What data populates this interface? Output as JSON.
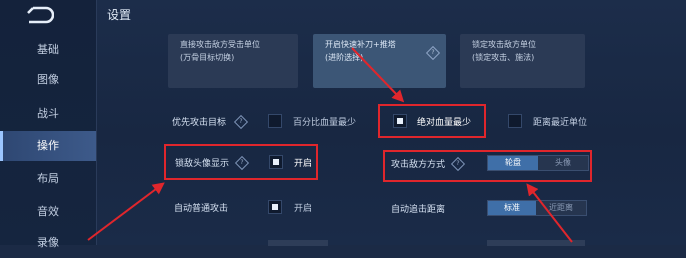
{
  "page": {
    "title": "设置"
  },
  "sidebar": {
    "items": [
      {
        "label": "基础"
      },
      {
        "label": "图像"
      },
      {
        "label": "战斗"
      },
      {
        "label": "操作",
        "active": true
      },
      {
        "label": "布局"
      },
      {
        "label": "音效"
      },
      {
        "label": "录像"
      }
    ]
  },
  "cards": [
    {
      "line1": "直接攻击敌方受击单位",
      "line2": "(万骨目标切换)",
      "selected": false
    },
    {
      "line1": "开启快速补刀+推塔",
      "line2": "(进阶选择)",
      "selected": true,
      "help": "?"
    },
    {
      "line1": "锁定攻击敌方单位",
      "line2": "(锁定攻击、施法)",
      "selected": false
    }
  ],
  "rows": {
    "priority": {
      "label": "优先攻击目标",
      "help": "?",
      "options": [
        {
          "label": "百分比血量最少",
          "checked": false
        },
        {
          "label": "绝对血量最少",
          "checked": true
        },
        {
          "label": "距离最近单位",
          "checked": false
        }
      ]
    },
    "lock_avatar": {
      "label": "锁敌头像显示",
      "help": "?",
      "checkbox_label": "开启",
      "checked": true
    },
    "attack_mode": {
      "label": "攻击敌方方式",
      "help": "?",
      "options": [
        "轮盘",
        "头像"
      ],
      "selected": "轮盘"
    },
    "auto_attack": {
      "label": "自动普通攻击",
      "checkbox_label": "开启",
      "checked": true
    },
    "auto_chase": {
      "label": "自动追击距离",
      "options": [
        "标准",
        "近距离"
      ],
      "selected": "标准"
    }
  },
  "colors": {
    "highlight": "#e0262c",
    "accent": "#3f6fa8",
    "background": "#1b2a45"
  }
}
